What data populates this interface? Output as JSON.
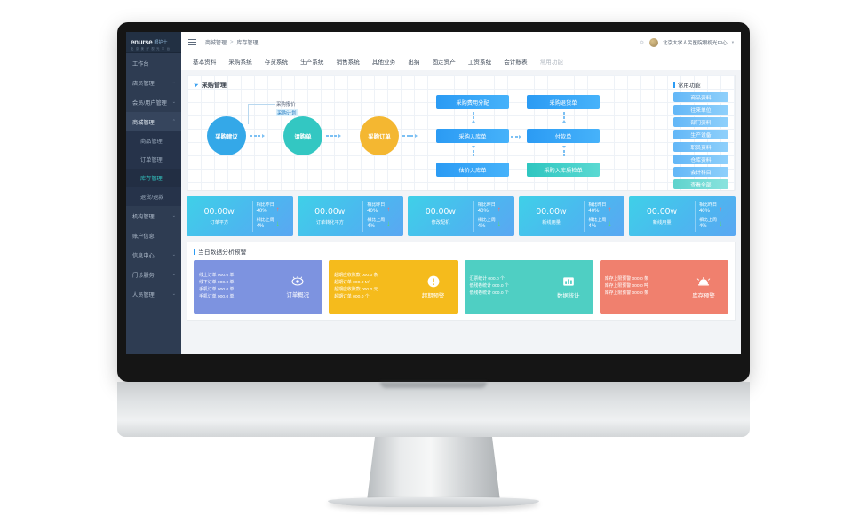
{
  "brand": {
    "name": "enurse",
    "cn": "眼护士",
    "sub": "北 京 美 好 视 光 平 台"
  },
  "topbar": {
    "menu_icon": "hamburger-icon",
    "breadcrumb_root": "商城管理",
    "breadcrumb_sep": ">",
    "breadcrumb_current": "库存管理",
    "bell_icon": "♧",
    "user_name": "北京大学人民医院眼视光中心",
    "caret": "▾"
  },
  "tabs": [
    {
      "label": "基本资料",
      "muted": false
    },
    {
      "label": "采购系统",
      "muted": false
    },
    {
      "label": "存货系统",
      "muted": false
    },
    {
      "label": "生产系统",
      "muted": false
    },
    {
      "label": "销售系统",
      "muted": false
    },
    {
      "label": "其他业务",
      "muted": false
    },
    {
      "label": "出纳",
      "muted": false
    },
    {
      "label": "固定资产",
      "muted": false
    },
    {
      "label": "工资系统",
      "muted": false
    },
    {
      "label": "会计账表",
      "muted": false
    },
    {
      "label": "常用功能",
      "muted": true
    }
  ],
  "sidebar": {
    "items": [
      {
        "label": "工作台",
        "chev": "",
        "open": false
      },
      {
        "label": "店员管理",
        "chev": "⌄",
        "open": false
      },
      {
        "label": "会员/用户管理",
        "chev": "⌄",
        "open": false
      },
      {
        "label": "商城管理",
        "chev": "⌃",
        "open": true
      },
      {
        "label": "机构管理",
        "chev": "⌄",
        "open": false
      },
      {
        "label": "账户信息",
        "chev": "",
        "open": false
      },
      {
        "label": "信息中心",
        "chev": "⌄",
        "open": false
      },
      {
        "label": "门诊服务",
        "chev": "⌄",
        "open": false
      },
      {
        "label": "人员管理",
        "chev": "⌄",
        "open": false
      }
    ],
    "submenu": [
      {
        "label": "商品管理",
        "active": false
      },
      {
        "label": "订单管理",
        "active": false
      },
      {
        "label": "库存管理",
        "active": true
      },
      {
        "label": "退货/退款",
        "active": false
      }
    ]
  },
  "flow": {
    "title": "采购管理",
    "send_icon": "➤",
    "circles": [
      {
        "label": "采购建议",
        "color": "#34a8e8"
      },
      {
        "label": "请购单",
        "color": "#33c7c2"
      },
      {
        "label": "采购订单",
        "color": "#f4b731"
      }
    ],
    "callouts": [
      {
        "label": "采购报价",
        "highlight": false
      },
      {
        "label": "采购计划",
        "highlight": true
      }
    ],
    "boxes": [
      {
        "label": "采购费用分配",
        "style": "blue"
      },
      {
        "label": "采购退货单",
        "style": "blue"
      },
      {
        "label": "采购入库单",
        "style": "blue"
      },
      {
        "label": "付款单",
        "style": "blue"
      },
      {
        "label": "估价入库单",
        "style": "blue"
      },
      {
        "label": "采购入库质检单",
        "style": "teal"
      }
    ]
  },
  "quick": {
    "title": "常用功能",
    "buttons": [
      {
        "label": "商品资料",
        "style": "blue"
      },
      {
        "label": "往来单位",
        "style": "blue"
      },
      {
        "label": "部门资料",
        "style": "blue"
      },
      {
        "label": "生产设备",
        "style": "blue"
      },
      {
        "label": "职员资料",
        "style": "blue"
      },
      {
        "label": "仓库资料",
        "style": "blue"
      },
      {
        "label": "会计科目",
        "style": "blue"
      },
      {
        "label": "查看全部",
        "style": "teal"
      }
    ]
  },
  "stats": [
    {
      "value": "00.00w",
      "label": "订单平方",
      "cmp1_label": "相比昨日",
      "cmp1_value": "40%",
      "cmp1_dir": "up",
      "cmp2_label": "相比上周",
      "cmp2_value": "4%",
      "cmp2_dir": "down"
    },
    {
      "value": "00.00w",
      "label": "订单转化平方",
      "cmp1_label": "相比昨日",
      "cmp1_value": "40%",
      "cmp1_dir": "up",
      "cmp2_label": "相比上周",
      "cmp2_value": "4%",
      "cmp2_dir": "down"
    },
    {
      "value": "00.00w",
      "label": "修改配机",
      "cmp1_label": "相比昨日",
      "cmp1_value": "40%",
      "cmp1_dir": "up",
      "cmp2_label": "相比上周",
      "cmp2_value": "4%",
      "cmp2_dir": "down"
    },
    {
      "value": "00.00w",
      "label": "新线用量",
      "cmp1_label": "相比昨日",
      "cmp1_value": "40%",
      "cmp1_dir": "up",
      "cmp2_label": "相比上周",
      "cmp2_value": "4%",
      "cmp2_dir": "down"
    },
    {
      "value": "00.00w",
      "label": "新线用量",
      "cmp1_label": "相比昨日",
      "cmp1_value": "40%",
      "cmp1_dir": "up",
      "cmp2_label": "相比上周",
      "cmp2_value": "4%",
      "cmp2_dir": "down"
    }
  ],
  "bottom": {
    "title": "当日数据分析预警",
    "cards": [
      {
        "style": "blue",
        "icon": "eye-icon",
        "glyph": "👁",
        "label": "订单概况",
        "lines": [
          "线上订单  000.0 单",
          "线下订单  000.0 单",
          "手机订单  000.0 单",
          "手机订单  000.0 单"
        ]
      },
      {
        "style": "yellow",
        "icon": "alert-icon",
        "glyph": "❗",
        "label": "超期预警",
        "lines": [
          "超期应收账款  000.0 条",
          "超期订单   000.0 M²",
          "超期应收账款  000.0 元",
          "超期订单   000.0 个"
        ]
      },
      {
        "style": "teal",
        "icon": "bar-chart-icon",
        "glyph": "📊",
        "label": "数据统计",
        "lines": [
          "汇票统计  000.0 个",
          "低残卷统计  000.0 个",
          "低残卷统计  000.0 个"
        ]
      },
      {
        "style": "coral",
        "icon": "bell-alarm-icon",
        "glyph": "🔔",
        "label": "库存预警",
        "lines": [
          "库存上限预警  000.0 条",
          "库存上限预警  000.0 吨",
          "库存上限预警  000.0 条"
        ]
      }
    ]
  }
}
